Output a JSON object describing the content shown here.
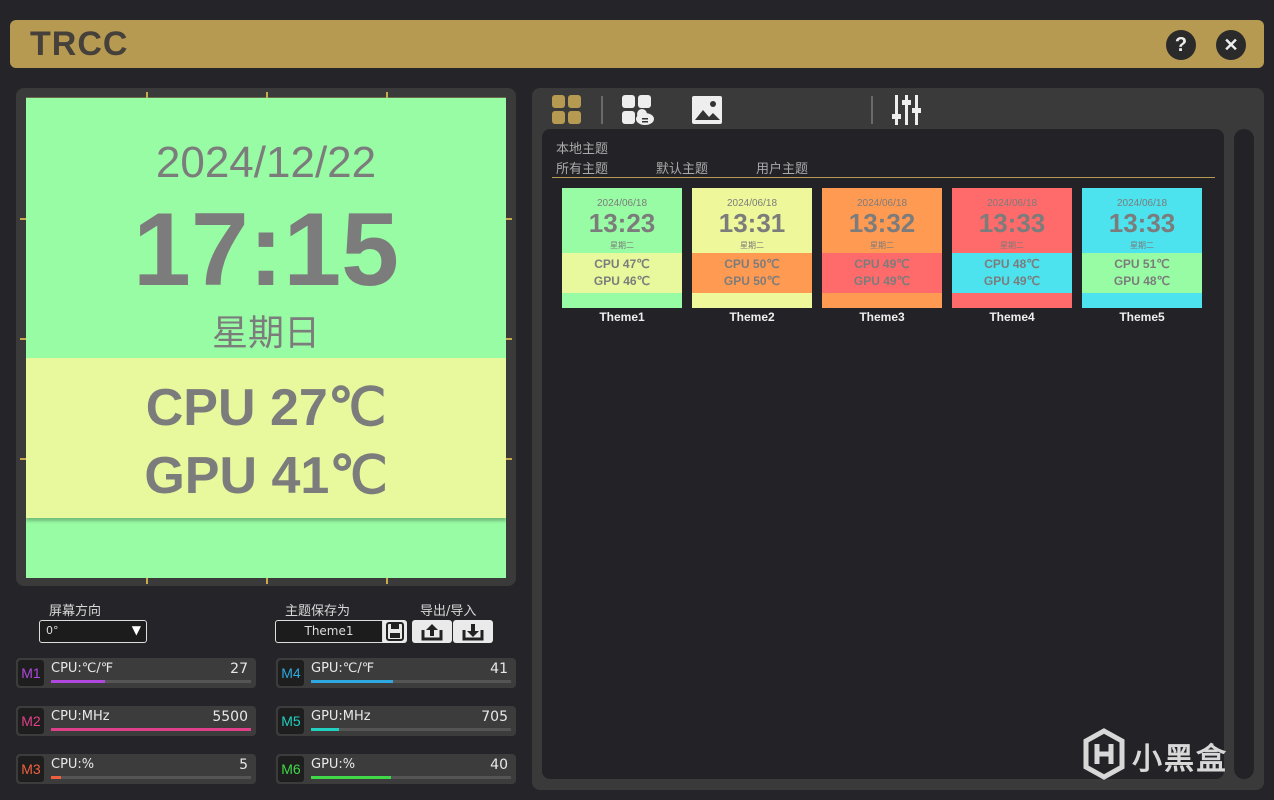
{
  "app": {
    "title": "TRCC",
    "help_label": "?",
    "close_label": "✕"
  },
  "preview": {
    "date": "2024/12/22",
    "time": "17:15",
    "weekday": "星期日",
    "cpu_line": "CPU  27℃",
    "gpu_line": "GPU  41℃",
    "colors": {
      "top": "#98fca4",
      "stats": "#e8f89c",
      "text": "#7c7c7c"
    }
  },
  "controls": {
    "orientation_label": "屏幕方向",
    "orientation_value": "0°",
    "save_label": "主题保存为",
    "save_value": "Theme1",
    "export_label": "导出/导入"
  },
  "monitors": [
    {
      "tag": "M1",
      "label": "CPU:℃/℉",
      "value": "27",
      "fill": 0.27,
      "color": "#b048e0"
    },
    {
      "tag": "M2",
      "label": "CPU:MHz",
      "value": "5500",
      "fill": 1.0,
      "color": "#e0408a"
    },
    {
      "tag": "M3",
      "label": "CPU:%",
      "value": "5",
      "fill": 0.05,
      "color": "#f06040"
    },
    {
      "tag": "M4",
      "label": "GPU:℃/℉",
      "value": "41",
      "fill": 0.41,
      "color": "#2ea8e0"
    },
    {
      "tag": "M5",
      "label": "GPU:MHz",
      "value": "705",
      "fill": 0.14,
      "color": "#20d0c0"
    },
    {
      "tag": "M6",
      "label": "GPU:%",
      "value": "40",
      "fill": 0.4,
      "color": "#40d848"
    }
  ],
  "gallery": {
    "title": "本地主题",
    "tabs": [
      "所有主题",
      "默认主题",
      "用户主题"
    ],
    "themes": [
      {
        "name": "Theme1",
        "date": "2024/06/18",
        "time": "13:23",
        "weekday": "星期二",
        "cpu": "CPU  47℃",
        "gpu": "GPU  46℃",
        "top": "#98fca4",
        "mid": "#e8f89c"
      },
      {
        "name": "Theme2",
        "date": "2024/06/18",
        "time": "13:31",
        "weekday": "星期二",
        "cpu": "CPU  50℃",
        "gpu": "GPU  50℃",
        "top": "#eef89a",
        "mid": "#ff9a52"
      },
      {
        "name": "Theme3",
        "date": "2024/06/18",
        "time": "13:32",
        "weekday": "星期二",
        "cpu": "CPU  49℃",
        "gpu": "GPU  49℃",
        "top": "#ff9a52",
        "mid": "#ff6a6a"
      },
      {
        "name": "Theme4",
        "date": "2024/06/18",
        "time": "13:33",
        "weekday": "星期二",
        "cpu": "CPU  48℃",
        "gpu": "GPU  49℃",
        "top": "#ff6a6a",
        "mid": "#4ce2ee"
      },
      {
        "name": "Theme5",
        "date": "2024/06/18",
        "time": "13:33",
        "weekday": "星期二",
        "cpu": "CPU  51℃",
        "gpu": "GPU  48℃",
        "top": "#4ce2ee",
        "mid": "#98fca4"
      }
    ]
  },
  "watermark": {
    "text": "小黑盒"
  },
  "colors": {
    "accent": "#b69a52",
    "panel": "#3a3a3a",
    "background": "#252429"
  }
}
